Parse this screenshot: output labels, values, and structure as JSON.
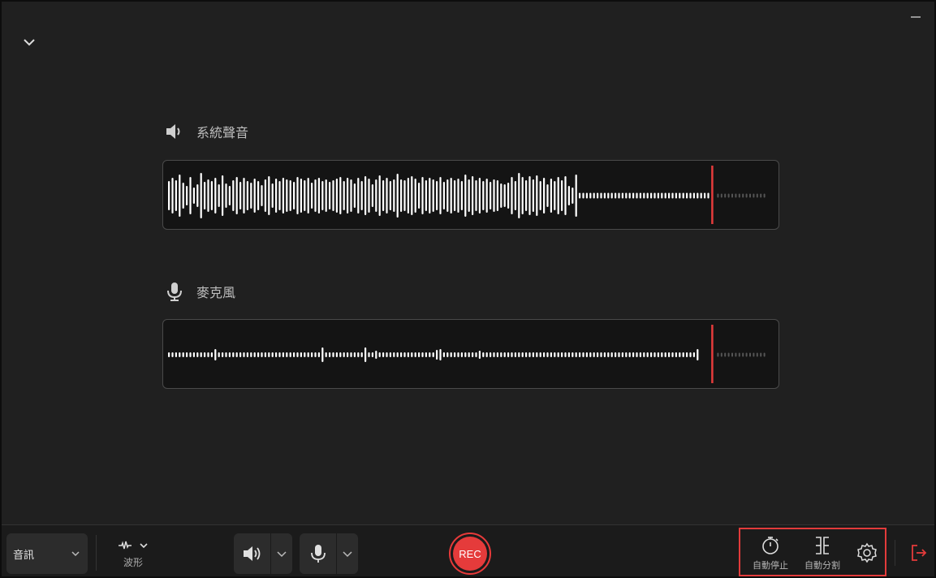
{
  "tracks": {
    "system": {
      "label": "系統聲音",
      "icon": "speaker-icon",
      "bars": [
        36,
        44,
        38,
        52,
        32,
        24,
        46,
        20,
        28,
        56,
        34,
        40,
        36,
        44,
        28,
        50,
        30,
        24,
        38,
        46,
        34,
        44,
        36,
        32,
        42,
        36,
        26,
        40,
        48,
        30,
        42,
        36,
        44,
        40,
        38,
        34,
        46,
        42,
        38,
        44,
        32,
        40,
        44,
        36,
        40,
        34,
        38,
        42,
        46,
        36,
        44,
        40,
        30,
        44,
        36,
        48,
        42,
        28,
        40,
        50,
        38,
        44,
        36,
        40,
        54,
        40,
        38,
        44,
        48,
        42,
        32,
        46,
        38,
        44,
        40,
        36,
        46,
        34,
        40,
        44,
        38,
        42,
        36,
        52,
        40,
        48,
        38,
        44,
        36,
        42,
        34,
        40,
        38,
        30,
        28,
        32,
        46,
        36,
        56,
        46,
        38,
        48,
        40,
        50,
        36,
        44,
        28,
        42,
        36,
        46,
        38,
        48,
        24,
        20,
        52
      ],
      "trail_count": 14,
      "playhead_fraction": 0.89
    },
    "mic": {
      "label": "麥克風",
      "icon": "microphone-icon",
      "spikes": [
        {
          "i": 13,
          "h": 14
        },
        {
          "i": 43,
          "h": 18
        },
        {
          "i": 55,
          "h": 18
        },
        {
          "i": 58,
          "h": 10
        },
        {
          "i": 75,
          "h": 12
        },
        {
          "i": 76,
          "h": 14
        },
        {
          "i": 87,
          "h": 10
        },
        {
          "i": 148,
          "h": 14
        }
      ],
      "bar_count": 149,
      "trail_count": 14,
      "playhead_fraction": 0.89
    }
  },
  "bottombar": {
    "mode_select": "音訊",
    "waveform_label": "波形",
    "rec_label": "REC",
    "auto_stop_label": "自動停止",
    "auto_split_label": "自動分割"
  },
  "colors": {
    "accent": "#e53b3b",
    "wave": "#ffffff",
    "trail": "#555555"
  }
}
